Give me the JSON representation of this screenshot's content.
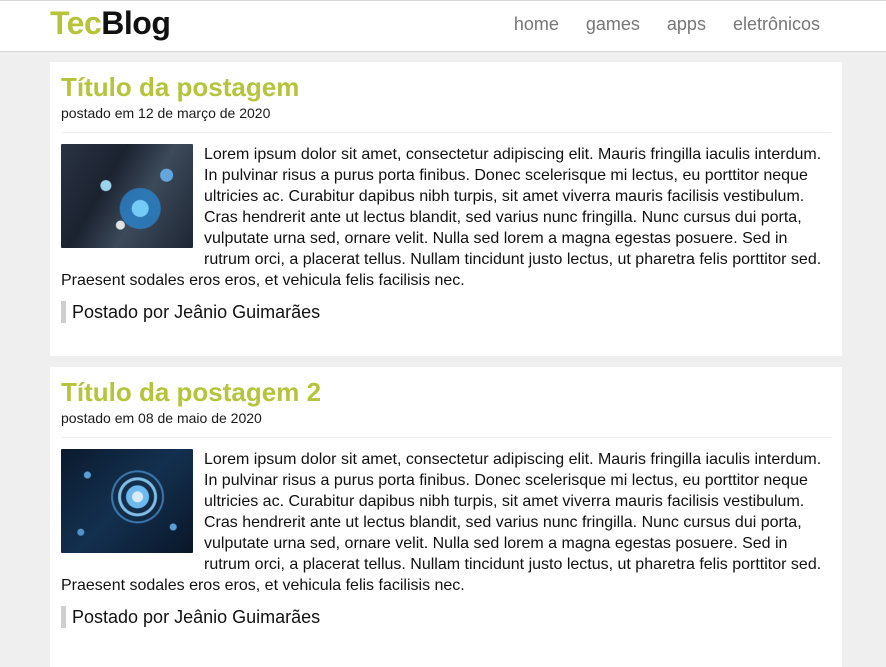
{
  "brand": {
    "part1": "Tec",
    "part2": "Blog"
  },
  "nav": {
    "items": [
      {
        "label": "home"
      },
      {
        "label": "games"
      },
      {
        "label": "apps"
      },
      {
        "label": "eletrônicos"
      }
    ]
  },
  "posts": [
    {
      "title": "Título da postagem",
      "date": "postado em 12 de março de 2020",
      "image": "technology-hand-icon",
      "body": "Lorem ipsum dolor sit amet, consectetur adipiscing elit. Mauris fringilla iaculis interdum. In pulvinar risus a purus porta finibus. Donec scelerisque mi lectus, eu porttitor neque ultricies ac. Curabitur dapibus nibh turpis, sit amet viverra mauris facilisis vestibulum. Cras hendrerit ante ut lectus blandit, sed varius nunc fringilla. Nunc cursus dui porta, vulputate urna sed, ornare velit. Nulla sed lorem a magna egestas posuere. Sed in rutrum orci, a placerat tellus. Nullam tincidunt justo lectus, ut pharetra felis porttitor sed. Praesent sodales eros eros, et vehicula felis facilisis nec.",
      "author": "Postado por Jeânio Guimarães"
    },
    {
      "title": "Título da postagem 2",
      "date": "postado em 08 de maio de 2020",
      "image": "digital-network-icon",
      "body": "Lorem ipsum dolor sit amet, consectetur adipiscing elit. Mauris fringilla iaculis interdum. In pulvinar risus a purus porta finibus. Donec scelerisque mi lectus, eu porttitor neque ultricies ac. Curabitur dapibus nibh turpis, sit amet viverra mauris facilisis vestibulum. Cras hendrerit ante ut lectus blandit, sed varius nunc fringilla. Nunc cursus dui porta, vulputate urna sed, ornare velit. Nulla sed lorem a magna egestas posuere. Sed in rutrum orci, a placerat tellus. Nullam tincidunt justo lectus, ut pharetra felis porttitor sed. Praesent sodales eros eros, et vehicula felis facilisis nec.",
      "author": "Postado por Jeânio Guimarães"
    }
  ],
  "colors": {
    "accent": "#b5c43a",
    "nav_text": "#777777",
    "page_bg": "#efefef",
    "card_bg": "#ffffff",
    "author_bar": "#cfcfcf"
  }
}
